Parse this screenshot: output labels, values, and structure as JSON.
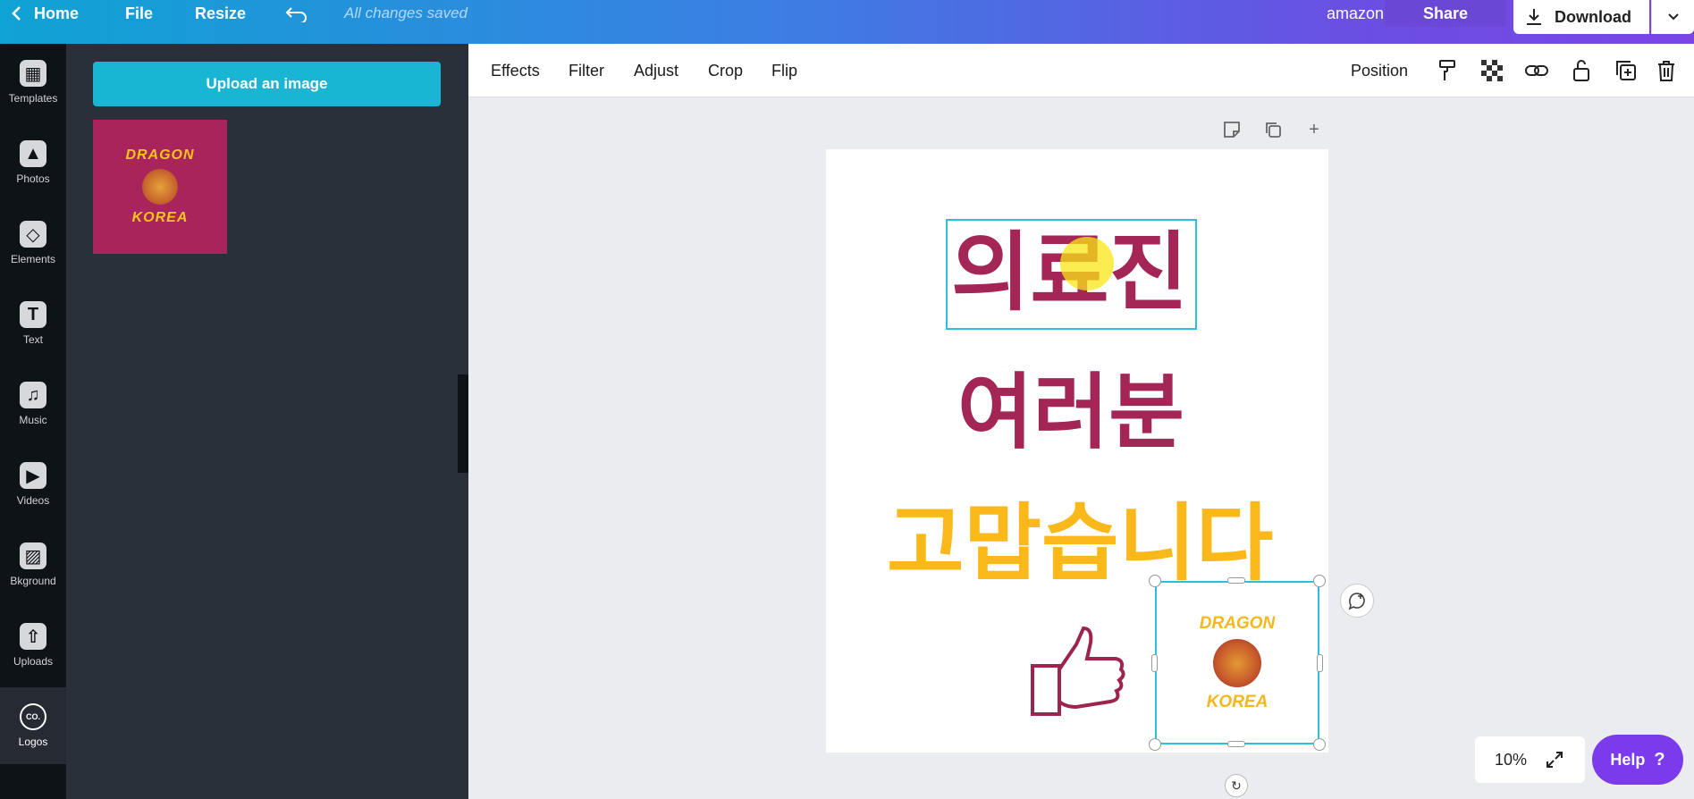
{
  "topbar": {
    "home": "Home",
    "file": "File",
    "resize": "Resize",
    "status": "All changes saved",
    "design_name": "amazon",
    "share": "Share",
    "download": "Download"
  },
  "rail": {
    "items": [
      {
        "label": "Templates",
        "icon": "templates-icon"
      },
      {
        "label": "Photos",
        "icon": "photos-icon"
      },
      {
        "label": "Elements",
        "icon": "elements-icon"
      },
      {
        "label": "Text",
        "icon": "text-icon"
      },
      {
        "label": "Music",
        "icon": "music-icon"
      },
      {
        "label": "Videos",
        "icon": "videos-icon"
      },
      {
        "label": "Bkground",
        "icon": "background-icon"
      },
      {
        "label": "Uploads",
        "icon": "uploads-icon"
      },
      {
        "label": "Logos",
        "icon": "logos-icon"
      }
    ],
    "logos_icon_text": "CO."
  },
  "panel": {
    "upload_button": "Upload an image",
    "thumb_top": "DRAGON",
    "thumb_bottom": "KOREA"
  },
  "toolbar": {
    "effects": "Effects",
    "filter": "Filter",
    "adjust": "Adjust",
    "crop": "Crop",
    "flip": "Flip",
    "position": "Position"
  },
  "canvas": {
    "line1": "의료진",
    "line2": "여러분",
    "line3": "고맙습니다",
    "logo_top": "DRAGON",
    "logo_bottom": "KOREA"
  },
  "zoom": {
    "value": "10%"
  },
  "help": {
    "label": "Help",
    "icon": "?"
  },
  "colors": {
    "crimson": "#a32656",
    "gold": "#fbb81b",
    "selection": "#29c1d9",
    "help_purple": "#7c3aed"
  }
}
